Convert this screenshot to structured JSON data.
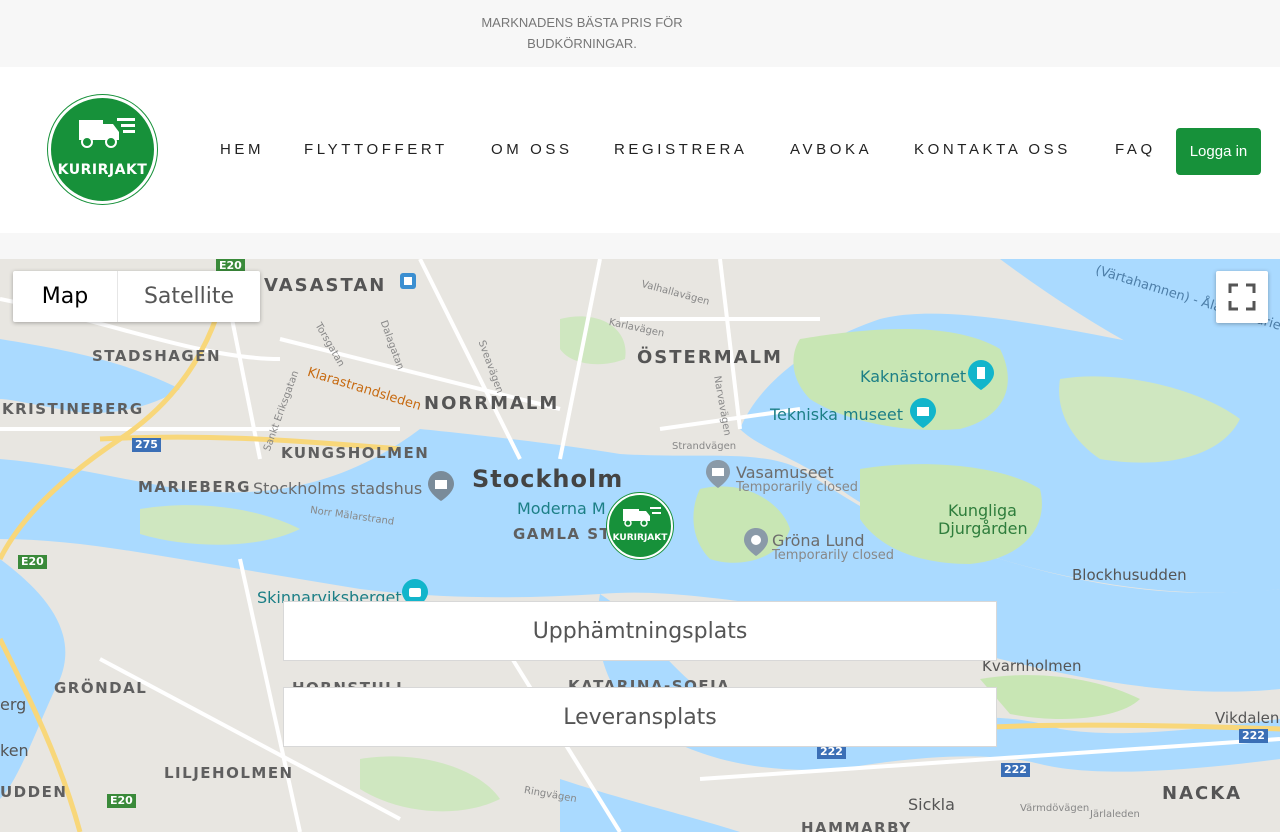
{
  "topbar": {
    "tagline": "MARKNADENS BÄSTA PRIS FÖR BUDKÖRNINGAR."
  },
  "logo": {
    "text": "KURIRJAKT"
  },
  "nav": {
    "items": [
      "HEM",
      "FLYTTOFFERT",
      "OM OSS",
      "REGISTRERA",
      "AVBOKA",
      "KONTAKTA OSS",
      "FAQ"
    ],
    "login": "Logga in"
  },
  "map": {
    "type_map": "Map",
    "type_satellite": "Satellite",
    "marker_text": "KURIRJAKT",
    "labels": {
      "vasastan": "VASASTAN",
      "ostermalm": "ÖSTERMALM",
      "stadshagen": "STADSHAGEN",
      "kristineberg": "KRISTINEBERG",
      "norrmalm": "NORRMALM",
      "kungsholmen": "KUNGSHOLMEN",
      "marieberg": "MARIEBERG",
      "stockholm": "Stockholm",
      "stadshus": "Stockholms stadshus",
      "moderna": "Moderna M",
      "gamlastan": "GAMLA ST",
      "kaknas": "Kaknästornet",
      "tekniska": "Tekniska museet",
      "vasamuseet": "Vasamuseet",
      "vasa_closed": "Temporarily closed",
      "grona": "Gröna Lund",
      "grona_closed": "Temporarily closed",
      "djurgarden1": "Kungliga",
      "djurgarden2": "Djurgården",
      "blockhus": "Blockhusudden",
      "skinnar": "Skinnarviksberget",
      "kvarnholmen": "Kvarnholmen",
      "grondal": "GRÖNDAL",
      "hornstull": "HORNSTULL",
      "katarina": "KATARINA-SOFIA",
      "liljeholmen": "LILJEHOLMEN",
      "vikdalen": "Vikdalen",
      "nacka": "NACKA",
      "sickla": "Sickla",
      "hammarby": "HAMMARBY",
      "udden": "UDDEN",
      "erg": "erg",
      "ken": "ken",
      "klarastrand": "Klarastrandsleden",
      "aland": "(Värtahamnen) - Åland (Mariehamn)",
      "strandvagen": "Strandvägen",
      "valhalla": "Valhallavägen",
      "karlavagen": "Karlavägen",
      "norr_malar": "Norr Mälarstrand",
      "ringvagen": "Ringvägen",
      "varmdo": "Värmdövägen",
      "jarla": "Järlaleden",
      "sankt": "Sankt Eriksgatan",
      "torsgatan": "Torsgatan",
      "dalagatan": "Dalagatan",
      "sveavagen": "Sveavägen",
      "narvavagen": "Narvavägen",
      "e20": "E20",
      "r275": "275",
      "r222": "222"
    }
  },
  "form": {
    "pickup_placeholder": "Upphämtningsplats",
    "delivery_placeholder": "Leveransplats"
  },
  "colors": {
    "brand_green": "#17913a",
    "water": "#aadaff",
    "park": "#c8e6b4"
  }
}
